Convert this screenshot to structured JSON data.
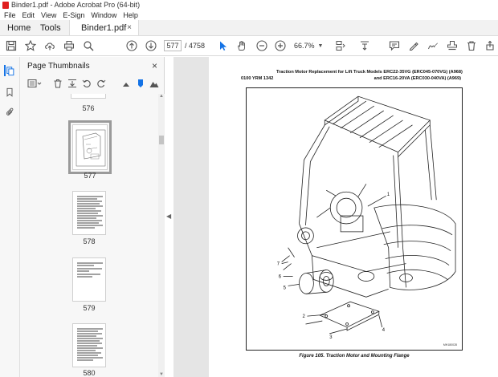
{
  "window": {
    "title": "Binder1.pdf - Adobe Acrobat Pro (64-bit)"
  },
  "menu": [
    "File",
    "Edit",
    "View",
    "E-Sign",
    "Window",
    "Help"
  ],
  "tabs": {
    "home": "Home",
    "tools": "Tools",
    "document": "Binder1.pdf",
    "close": "×"
  },
  "toolbar": {
    "page_current": "577",
    "page_total": "/ 4758",
    "zoom": "66.7%"
  },
  "panel": {
    "title": "Page Thumbnails",
    "close": "×",
    "thumbnails": [
      {
        "label": "576"
      },
      {
        "label": "577",
        "selected": true
      },
      {
        "label": "578"
      },
      {
        "label": "579"
      },
      {
        "label": "580"
      }
    ]
  },
  "document": {
    "title_line1": "Traction Motor Replacement for Lift Truck Models ERC22-35VG (ERC045-070VG) (A968)",
    "title_line2": "and ERC16-20VA (ERC030-040VA) (A969)",
    "code": "0100 YRM 1342",
    "figure_caption": "Figure 105. Traction Motor and Mounting Flange",
    "figure_id": "MH180028",
    "callouts": [
      "1",
      "2",
      "3",
      "4",
      "5",
      "6",
      "7"
    ]
  },
  "colors": {
    "accent": "#1473e6",
    "acrobat_red": "#e01e1e"
  }
}
